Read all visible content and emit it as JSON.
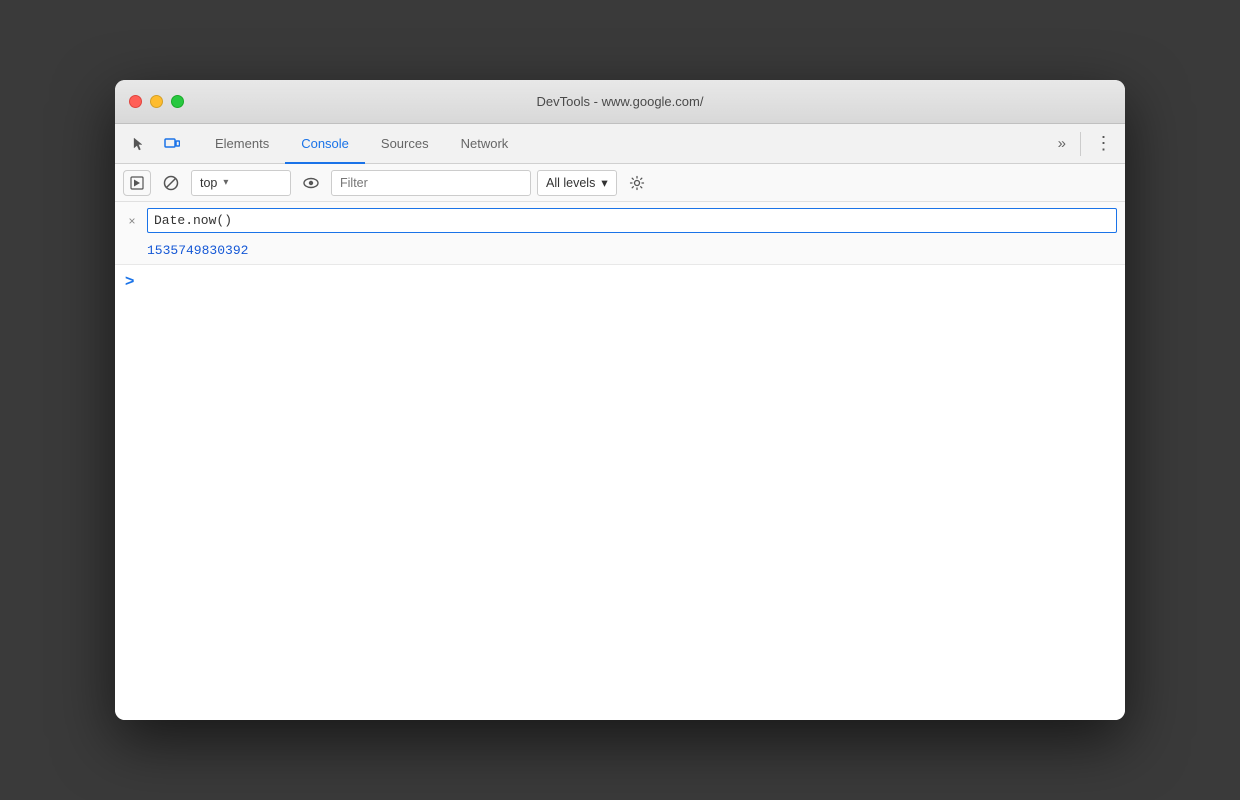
{
  "window": {
    "title": "DevTools - www.google.com/"
  },
  "traffic_lights": {
    "close_label": "close",
    "minimize_label": "minimize",
    "maximize_label": "maximize"
  },
  "tabs": {
    "items": [
      {
        "id": "elements",
        "label": "Elements",
        "active": false
      },
      {
        "id": "console",
        "label": "Console",
        "active": true
      },
      {
        "id": "sources",
        "label": "Sources",
        "active": false
      },
      {
        "id": "network",
        "label": "Network",
        "active": false
      }
    ],
    "more_label": "»",
    "menu_label": "⋮"
  },
  "toolbar": {
    "context_value": "top",
    "context_arrow": "▾",
    "filter_placeholder": "Filter",
    "levels_label": "All levels",
    "levels_arrow": "▾"
  },
  "console": {
    "command_value": "Date.now()",
    "clear_symbol": "×",
    "result_value": "1535749830392",
    "prompt_symbol": ">"
  },
  "colors": {
    "active_tab": "#1a73e8",
    "result_blue": "#1558d6",
    "prompt_blue": "#1a73e8"
  }
}
